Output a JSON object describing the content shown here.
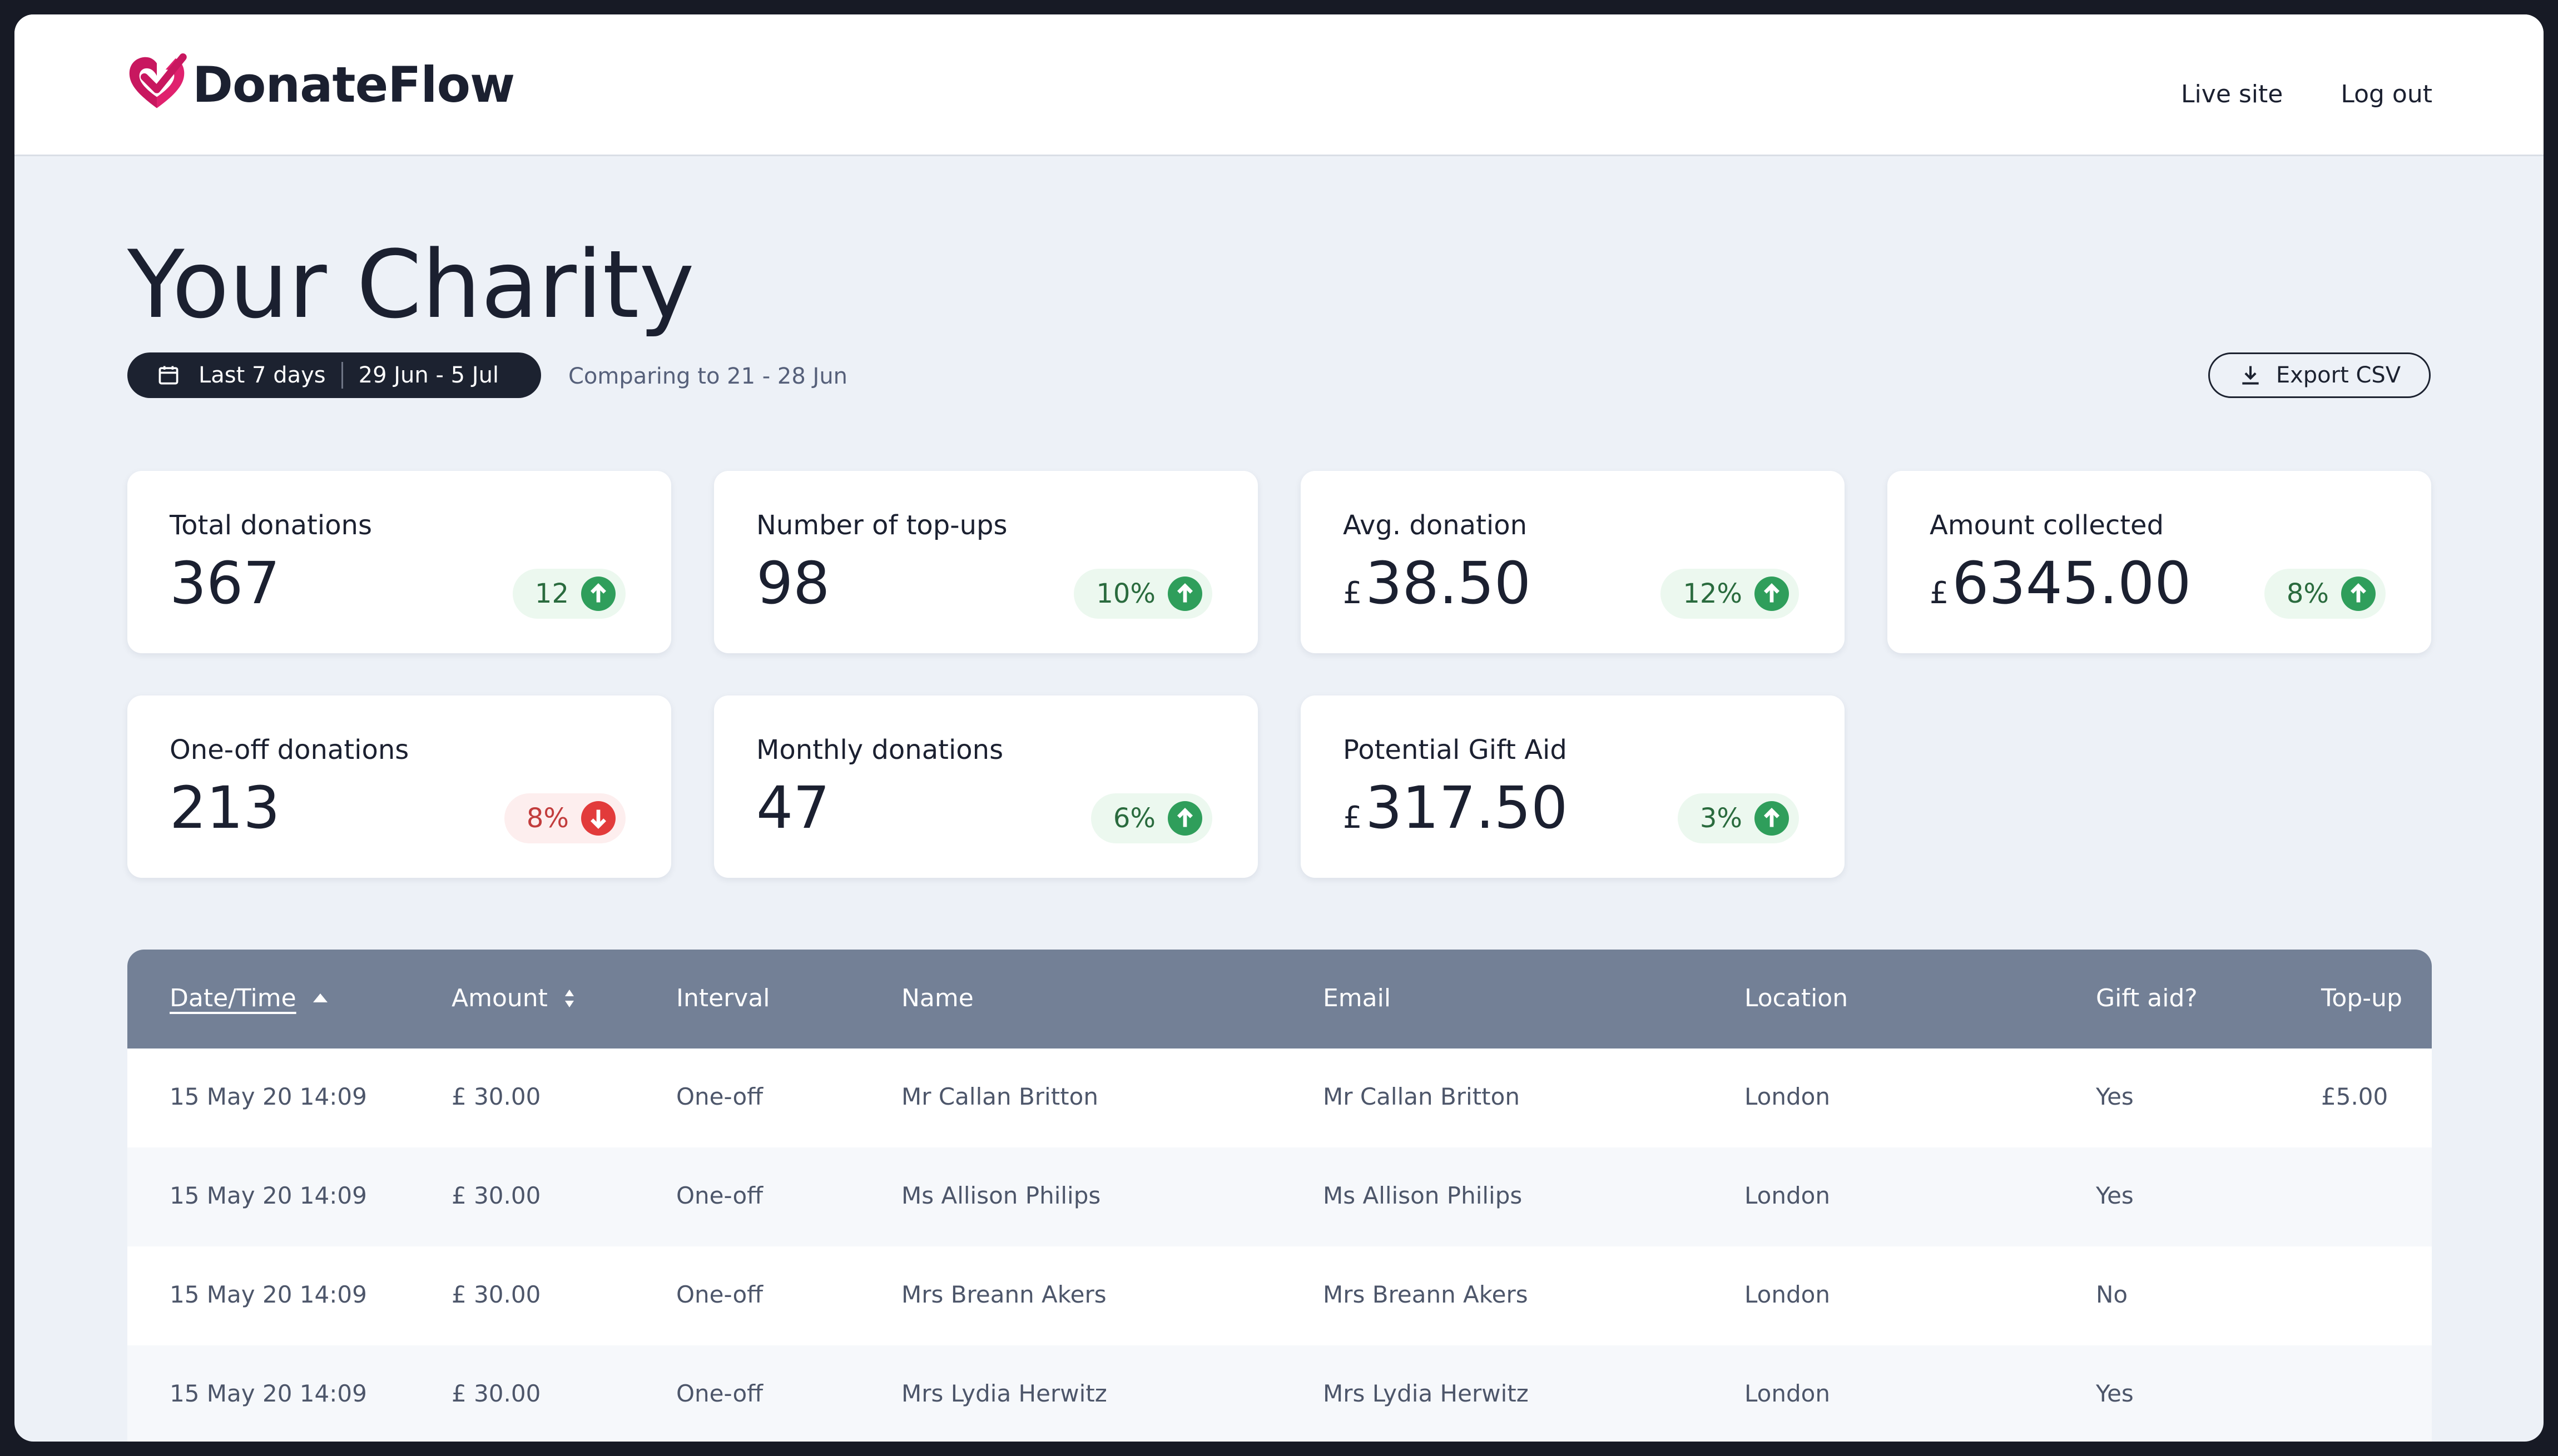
{
  "app": {
    "name": "DonateFlow"
  },
  "nav": {
    "live_site": "Live site",
    "log_out": "Log out"
  },
  "page": {
    "title": "Your Charity",
    "range_label": "Last 7 days",
    "range_dates": "29 Jun - 5 Jul",
    "comparing": "Comparing to 21 - 28 Jun",
    "export_label": "Export CSV"
  },
  "colors": {
    "brand": "#c8175f",
    "dark": "#1c2230",
    "up": "#2f9e5b",
    "down": "#e23b3b",
    "table_header": "#738096"
  },
  "stats": [
    {
      "label": "Total donations",
      "currency": "",
      "value": "367",
      "change": "12",
      "trend": "up"
    },
    {
      "label": "Number of top-ups",
      "currency": "",
      "value": "98",
      "change": "10%",
      "trend": "up"
    },
    {
      "label": "Avg. donation",
      "currency": "£",
      "value": "38.50",
      "change": "12%",
      "trend": "up"
    },
    {
      "label": "Amount collected",
      "currency": "£",
      "value": "6345.00",
      "change": "8%",
      "trend": "up"
    },
    {
      "label": "One-off donations",
      "currency": "",
      "value": "213",
      "change": "8%",
      "trend": "down"
    },
    {
      "label": "Monthly donations",
      "currency": "",
      "value": "47",
      "change": "6%",
      "trend": "up"
    },
    {
      "label": "Potential Gift Aid",
      "currency": "£",
      "value": "317.50",
      "change": "3%",
      "trend": "up"
    }
  ],
  "table": {
    "columns": [
      "Date/Time",
      "Amount",
      "Interval",
      "Name",
      "Email",
      "Location",
      "Gift aid?",
      "Top-up"
    ],
    "rows": [
      [
        "15 May 20 14:09",
        "£ 30.00",
        "One-off",
        "Mr Callan Britton",
        "Mr Callan Britton",
        "London",
        "Yes",
        "£5.00"
      ],
      [
        "15 May 20 14:09",
        "£ 30.00",
        "One-off",
        "Ms Allison Philips",
        "Ms Allison Philips",
        "London",
        "Yes",
        ""
      ],
      [
        "15 May 20 14:09",
        "£ 30.00",
        "One-off",
        "Mrs Breann Akers",
        "Mrs Breann Akers",
        "London",
        "No",
        ""
      ],
      [
        "15 May 20 14:09",
        "£ 30.00",
        "One-off",
        "Mrs Lydia Herwitz",
        "Mrs Lydia Herwitz",
        "London",
        "Yes",
        ""
      ]
    ]
  }
}
